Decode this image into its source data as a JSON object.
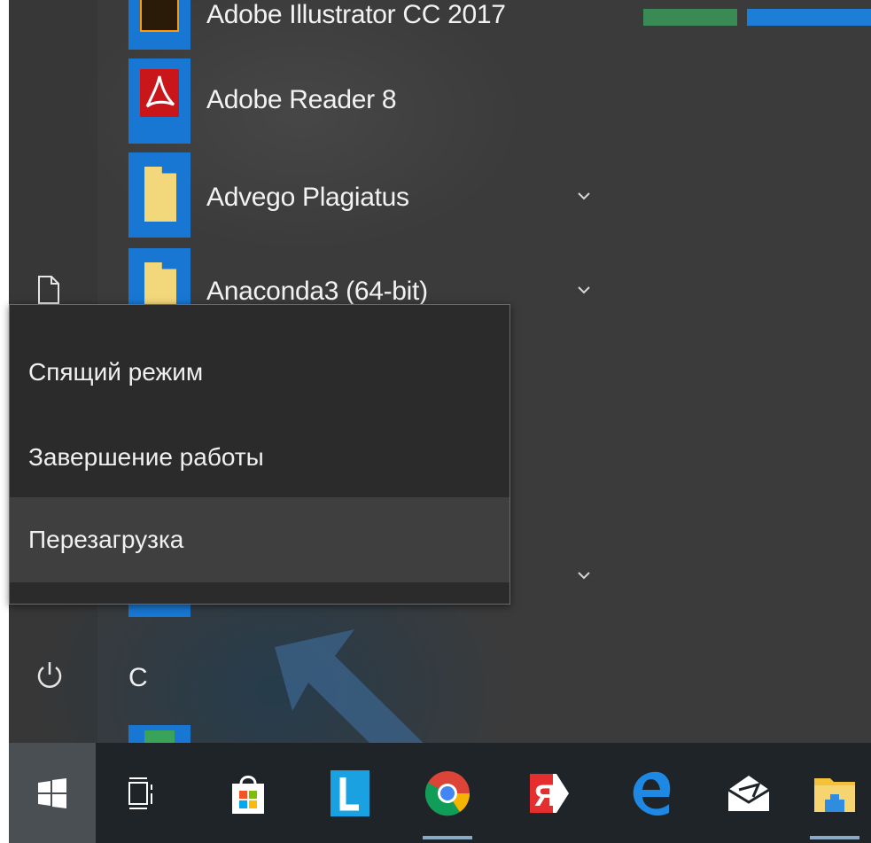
{
  "apps": [
    {
      "label": "Adobe Illustrator CC 2017",
      "icon": "adobe-illustrator-icon"
    },
    {
      "label": "Adobe Reader 8",
      "icon": "adobe-reader-icon"
    },
    {
      "label": "Advego Plagiatus",
      "icon": "folder-icon"
    },
    {
      "label": "Anaconda3 (64-bit)",
      "icon": "folder-icon"
    }
  ],
  "power_menu": {
    "items": [
      {
        "label": "Спящий режим"
      },
      {
        "label": "Завершение работы"
      },
      {
        "label": "Перезагрузка"
      }
    ]
  },
  "section_letter": "C",
  "taskbar": {
    "icons": [
      "windows-start-icon",
      "task-view-icon",
      "microsoft-store-icon",
      "lingvo-icon",
      "chrome-icon",
      "yandex-browser-icon",
      "edge-icon",
      "mail-icon",
      "file-explorer-icon"
    ]
  },
  "colors": {
    "tile_blue": "#1877d2",
    "flyout_bg": "#2b2b2b",
    "taskbar_bg": "#1f2428"
  }
}
